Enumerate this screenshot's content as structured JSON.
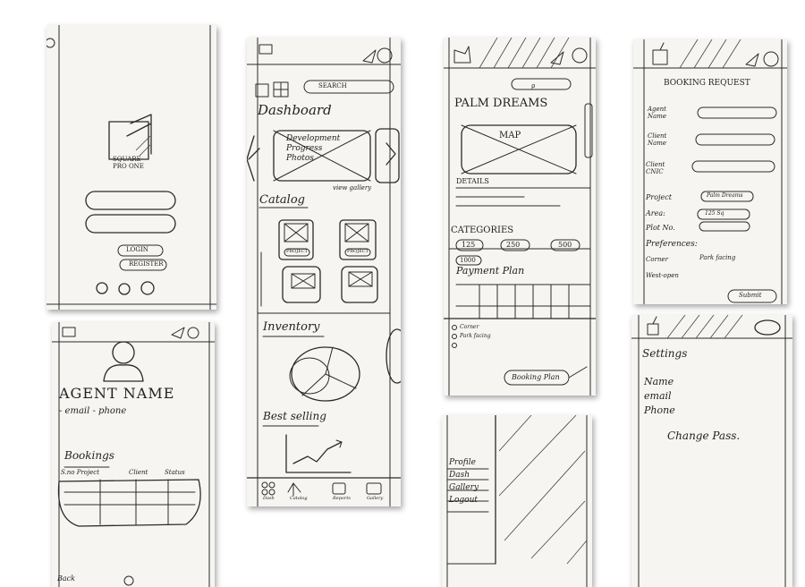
{
  "login": {
    "brand": "SQUARE PRO ONE",
    "login_label": "LOGIN",
    "register_label": "REGISTER"
  },
  "dashboard": {
    "search_label": "SEARCH",
    "title": "Dashboard",
    "carousel_caption": "Development Progress Photos",
    "view_gallery": "view gallery",
    "catalog_heading": "Catalog",
    "project_label_1": "PROJECT",
    "project_label_2": "PROJECT",
    "inventory_heading": "Inventory",
    "best_selling_heading": "Best selling",
    "tabs": [
      "Dash",
      "Catalog",
      "Reports",
      "Gallery"
    ]
  },
  "project": {
    "title": "PALM DREAMS",
    "map_label": "MAP",
    "details_heading": "DETAILS",
    "categories_heading": "CATEGORIES",
    "categories": [
      "125",
      "250",
      "500",
      "1000"
    ],
    "payment_plan_heading": "Payment Plan",
    "options": [
      "Corner",
      "Park facing",
      ""
    ],
    "booking_button": "Booking Plan"
  },
  "booking": {
    "title": "BOOKING REQUEST",
    "agent_name_label": "Agent Name",
    "client_name_label": "Client Name",
    "client_cnic_label": "Client CNIC",
    "project_label": "Project",
    "project_value": "Palm Dreams",
    "area_label": "Area:",
    "area_value": "125 Sq",
    "plot_label": "Plot No.",
    "preferences_label": "Preferences:",
    "pref_options": [
      "Corner",
      "Park facing",
      "West-open"
    ],
    "submit_label": "Submit"
  },
  "profile": {
    "agent_name": "AGENT NAME",
    "contact_line": "- email  - phone",
    "bookings_heading": "Bookings",
    "columns": [
      "S.no Project",
      "Client",
      "Status"
    ],
    "bottom_label": "Back"
  },
  "drawer": {
    "items": [
      "Profile",
      "Dash",
      "Gallery",
      "Logout"
    ]
  },
  "settings": {
    "title": "Settings",
    "fields": [
      "Name",
      "email",
      "Phone"
    ],
    "change_password": "Change Pass."
  }
}
